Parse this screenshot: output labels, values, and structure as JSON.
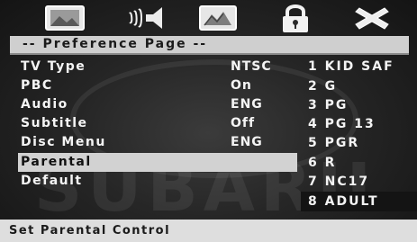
{
  "icons": [
    {
      "name": "general-setup-icon",
      "selected": false
    },
    {
      "name": "audio-setup-icon",
      "selected": false
    },
    {
      "name": "video-setup-icon",
      "selected": false
    },
    {
      "name": "lock-icon",
      "selected": false
    },
    {
      "name": "exit-icon",
      "selected": false
    }
  ],
  "page": {
    "title": "-- Preference Page --"
  },
  "watermark": {
    "text": "SUBARU"
  },
  "menu": [
    {
      "label": "TV Type",
      "value": "NTSC"
    },
    {
      "label": "PBC",
      "value": "On"
    },
    {
      "label": "Audio",
      "value": "ENG"
    },
    {
      "label": "Subtitle",
      "value": "Off"
    },
    {
      "label": "Disc Menu",
      "value": "ENG"
    },
    {
      "label": "Parental",
      "value": ""
    },
    {
      "label": "Default",
      "value": ""
    }
  ],
  "selected_menu": "Parental",
  "ratings": [
    "1 KID SAF",
    "2 G",
    "3 PG",
    "4 PG 13",
    "5 PGR",
    "6 R",
    "7 NC17",
    "8 ADULT"
  ],
  "selected_rating": "8 ADULT",
  "status": {
    "text": "Set Parental Control"
  },
  "colors": {
    "highlight": "#d2d2d2",
    "background": "#262626",
    "text": "#f4f4f4"
  }
}
